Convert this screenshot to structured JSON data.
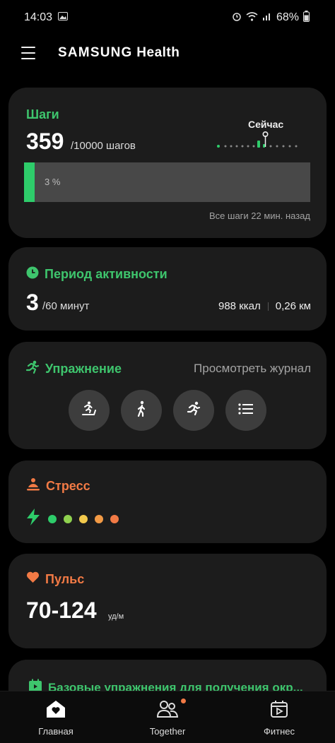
{
  "status_bar": {
    "time": "14:03",
    "battery": "68%"
  },
  "header": {
    "brand_part1": "SAMSUNG",
    "brand_part2": "Health"
  },
  "steps": {
    "title": "Шаги",
    "value": "359",
    "goal": "/10000 шагов",
    "now_label": "Сейчас",
    "progress_label": "3 %",
    "progress": 0.036,
    "note": "Все шаги 22 мин. назад"
  },
  "activity": {
    "title": "Период активности",
    "value": "3",
    "goal": "/60 минут",
    "calories": "988 ккал",
    "distance": "0,26 км"
  },
  "exercise": {
    "title": "Упражнение",
    "log_link": "Просмотреть журнал",
    "buttons": [
      "treadmill-icon",
      "walking-icon",
      "running-icon",
      "list-icon"
    ]
  },
  "stress": {
    "title": "Стресс",
    "levels": [
      "#2ecc6a",
      "#8fd14f",
      "#f2c94c",
      "#f29a45",
      "#f27a45"
    ]
  },
  "pulse": {
    "title": "Пульс",
    "value": "70-124",
    "unit": "уд/м"
  },
  "basics": {
    "title": "Базовые упражнения для получения окр..."
  },
  "nav": {
    "home": "Главная",
    "together": "Together",
    "fitness": "Фитнес"
  },
  "colors": {
    "accent_green": "#3ec56d",
    "accent_orange": "#f27a45",
    "card_bg": "#1c1c1c"
  }
}
